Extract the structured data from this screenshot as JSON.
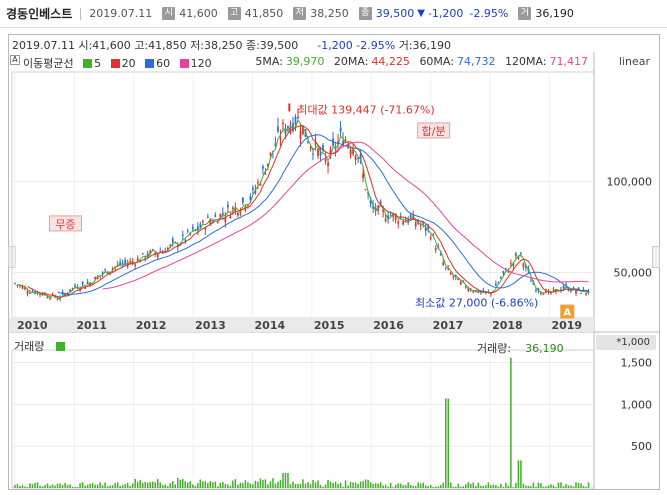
{
  "header": {
    "stock_name": "경동인베스트",
    "date": "2019.07.11",
    "open_label": "시",
    "open": "41,600",
    "high_label": "고",
    "high": "41,850",
    "low_label": "저",
    "low": "38,250",
    "close_label": "종",
    "close": "39,500",
    "change": "-1,200",
    "change_pct": "-2.95%",
    "volume_label": "거",
    "volume": "36,190",
    "down_arrow": "▼"
  },
  "info_line": {
    "date": "2019.07.11",
    "open": "시:41,600",
    "high": "고:41,850",
    "low": "저:38,250",
    "close": "종:39,500",
    "change": "-1,200",
    "change_pct": "-2.95%",
    "volume": "거:36,190"
  },
  "ma_legend": {
    "title": "이동평균선",
    "items": [
      {
        "label": "5",
        "color": "#43b02a"
      },
      {
        "label": "20",
        "color": "#e0322b"
      },
      {
        "label": "60",
        "color": "#2b6fd6"
      },
      {
        "label": "120",
        "color": "#e8459a"
      }
    ],
    "ma5_label": "5MA:",
    "ma5": "39,970",
    "ma20_label": "20MA:",
    "ma20": "44,225",
    "ma60_label": "60MA:",
    "ma60": "74,732",
    "ma120_label": "120MA:",
    "ma120": "71,417",
    "scale": "linear"
  },
  "annotations": {
    "max_label": "최대값 139,447 (-71.67%)",
    "min_label": "최소값 27,000 (-6.86%)",
    "event_1": "무증",
    "event_2": "합/분",
    "current_marker": "A"
  },
  "volume_panel": {
    "title": "거래량",
    "right_label": "거래량:",
    "right_value": "36,190",
    "unit": "*1,000"
  },
  "colors": {
    "up": "#e0322b",
    "down": "#2b6fd6",
    "ma5": "#43b02a",
    "ma20": "#e0322b",
    "ma60": "#2b6fd6",
    "ma120": "#e8459a",
    "volume": "#43b02a",
    "up_price": "#1c3fc9"
  },
  "chart_data": [
    {
      "type": "candlestick",
      "title": "",
      "x_ticks": [
        "2010",
        "2011",
        "2012",
        "2013",
        "2014",
        "2015",
        "2016",
        "2017",
        "2018",
        "2019"
      ],
      "y_ticks": [
        50000,
        100000
      ],
      "y_tick_labels": [
        "50,000",
        "100,000"
      ],
      "ylim": [
        25000,
        160000
      ],
      "scale": "linear",
      "series": [
        {
          "name": "5MA",
          "value": 39970
        },
        {
          "name": "20MA",
          "value": 44225
        },
        {
          "name": "60MA",
          "value": 74732
        },
        {
          "name": "120MA",
          "value": 71417
        }
      ],
      "max_value": 139447,
      "min_value": 27000,
      "approx_close_path": [
        [
          "2010-01",
          44000
        ],
        [
          "2010-04",
          40000
        ],
        [
          "2010-07",
          38000
        ],
        [
          "2010-10",
          36000
        ],
        [
          "2011-01",
          42000
        ],
        [
          "2011-04",
          44000
        ],
        [
          "2011-07",
          50000
        ],
        [
          "2011-10",
          54000
        ],
        [
          "2012-01",
          56000
        ],
        [
          "2012-04",
          60000
        ],
        [
          "2012-07",
          62000
        ],
        [
          "2012-10",
          66000
        ],
        [
          "2013-01",
          72000
        ],
        [
          "2013-04",
          78000
        ],
        [
          "2013-07",
          82000
        ],
        [
          "2013-10",
          86000
        ],
        [
          "2014-01",
          92000
        ],
        [
          "2014-04",
          110000
        ],
        [
          "2014-07",
          128000
        ],
        [
          "2014-10",
          135000
        ],
        [
          "2015-01",
          120000
        ],
        [
          "2015-04",
          110000
        ],
        [
          "2015-07",
          125000
        ],
        [
          "2015-10",
          118000
        ],
        [
          "2016-01",
          85000
        ],
        [
          "2016-04",
          82000
        ],
        [
          "2016-07",
          80000
        ],
        [
          "2016-10",
          78000
        ],
        [
          "2017-01",
          72000
        ],
        [
          "2017-04",
          52000
        ],
        [
          "2017-07",
          44000
        ],
        [
          "2017-10",
          40000
        ],
        [
          "2018-01",
          38000
        ],
        [
          "2018-04",
          50000
        ],
        [
          "2018-07",
          60000
        ],
        [
          "2018-10",
          42000
        ],
        [
          "2019-01",
          38000
        ],
        [
          "2019-04",
          42000
        ],
        [
          "2019-07",
          39500
        ]
      ]
    },
    {
      "type": "bar",
      "title": "거래량",
      "unit": "*1,000",
      "y_ticks": [
        500,
        1000,
        1500
      ],
      "y_tick_labels": [
        "500",
        "1,000",
        "1,500"
      ],
      "ylim": [
        0,
        1650
      ],
      "last_value": 36.19
    }
  ]
}
